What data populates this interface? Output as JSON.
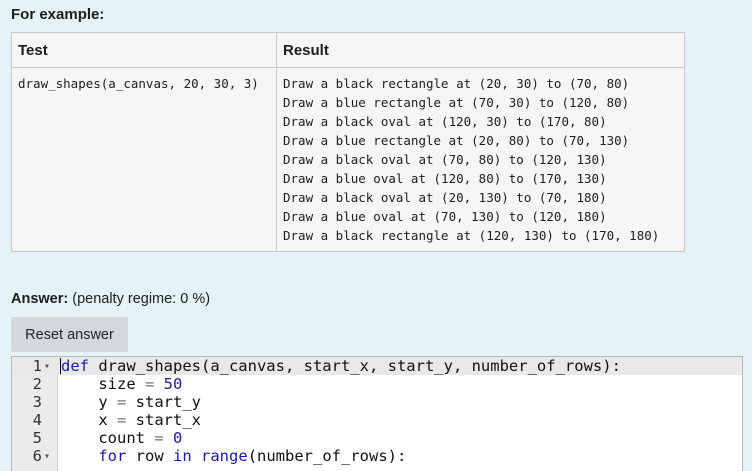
{
  "heading": "For example:",
  "table": {
    "headers": {
      "test": "Test",
      "result": "Result"
    },
    "test": "draw_shapes(a_canvas, 20, 30, 3)",
    "results": [
      "Draw a black rectangle at (20, 30) to (70, 80)",
      "Draw a blue rectangle at (70, 30) to (120, 80)",
      "Draw a black oval at (120, 30) to (170, 80)",
      "Draw a blue rectangle at (20, 80) to (70, 130)",
      "Draw a black oval at (70, 80) to (120, 130)",
      "Draw a blue oval at (120, 80) to (170, 130)",
      "Draw a black oval at (20, 130) to (70, 180)",
      "Draw a blue oval at (70, 130) to (120, 180)",
      "Draw a black rectangle at (120, 130) to (170, 180)"
    ]
  },
  "answer": {
    "label": "Answer:",
    "penalty": "(penalty regime: 0 %)"
  },
  "reset_label": "Reset answer",
  "editor": {
    "line_numbers": [
      "1",
      "2",
      "3",
      "4",
      "5",
      "6"
    ],
    "fold_markers": [
      "▾",
      "",
      "",
      "",
      "",
      "▾"
    ],
    "lines": {
      "l1": {
        "kw": "def",
        "rest": " draw_shapes(a_canvas, start_x, start_y, number_of_rows):"
      },
      "l2": {
        "indent": "    ",
        "name": "size",
        "op": " = ",
        "num": "50"
      },
      "l3": {
        "indent": "    ",
        "name": "y",
        "op": " = ",
        "rest": "start_y"
      },
      "l4": {
        "indent": "    ",
        "name": "x",
        "op": " = ",
        "rest": "start_x"
      },
      "l5": {
        "indent": "    ",
        "name": "count",
        "op": " = ",
        "num": "0"
      },
      "l6": {
        "indent": "    ",
        "kw1": "for",
        "mid": " row ",
        "kw2": "in",
        "sp": " ",
        "fn": "range",
        "rest": "(number_of_rows):"
      }
    }
  }
}
